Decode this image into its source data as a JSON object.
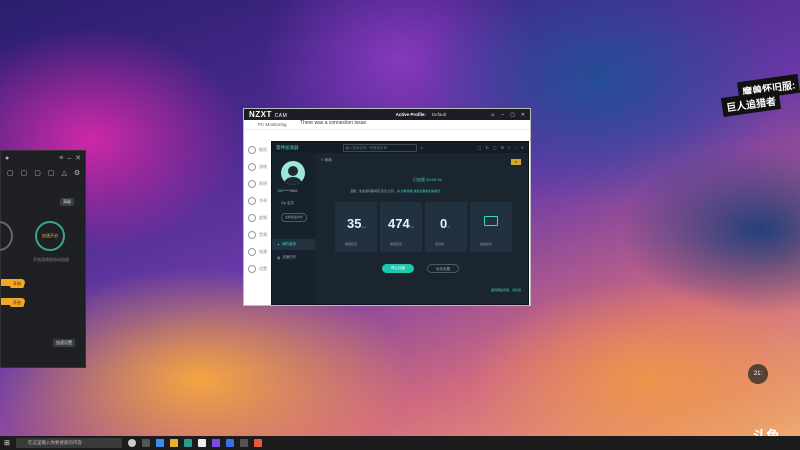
{
  "overlay": {
    "line1": "魔兽怀旧服:",
    "line2": "巨人追猎者",
    "clock_widget": "21:"
  },
  "left_app": {
    "button_top": "高级",
    "circle_label": "加速开启",
    "hint": "开始游戏前启动加速",
    "pill1": "开启",
    "pill2": "开启",
    "bottom_btn": "加速设置"
  },
  "nzxt": {
    "logo": "NZXT",
    "logo_sub": "CAM",
    "connection_msg": "There was a connection issue",
    "active_profile_label": "Active Profile:",
    "active_profile_value": "Default",
    "subbar": "PC Monitoring",
    "sidebar": [
      "概览",
      "游戏",
      "照明",
      "冷却",
      "超频",
      "音频",
      "电源",
      "设置"
    ]
  },
  "inner_app": {
    "brand": "雷神加速器",
    "search_placeholder": "输入游戏名称 / 拼音首字母",
    "refresh": "刷新",
    "username": "150*****5858",
    "vip": "Vip 会员",
    "redeem": "兑换加速时长",
    "nav": [
      "我的游戏",
      "加速历史"
    ],
    "timer": "已加速 00:00:34",
    "tagline_pre": "温馨：加速游戏期间若",
    "tagline_link1": "延迟",
    "tagline_mid": "过高，请",
    "tagline_link2": "切换线路",
    "tagline_link3": "或尝试其他加速模式",
    "cards": [
      {
        "value": "35",
        "unit": "ms",
        "label": "网络延迟"
      },
      {
        "value": "474",
        "unit": "ms",
        "label": "降低延迟"
      },
      {
        "value": "0",
        "unit": "%",
        "label": "丢包率"
      },
      {
        "value": "",
        "unit": "",
        "label": "加速模式"
      }
    ],
    "primary_button": "停止加速",
    "secondary_button": "优化设置",
    "footer_link": "遇到网络问题，请反馈"
  },
  "taskbar": {
    "search_placeholder": "在这里输入你要搜索的内容"
  },
  "watermark": {
    "logo": "斗鱼",
    "sub": "DOUYU.COM"
  }
}
